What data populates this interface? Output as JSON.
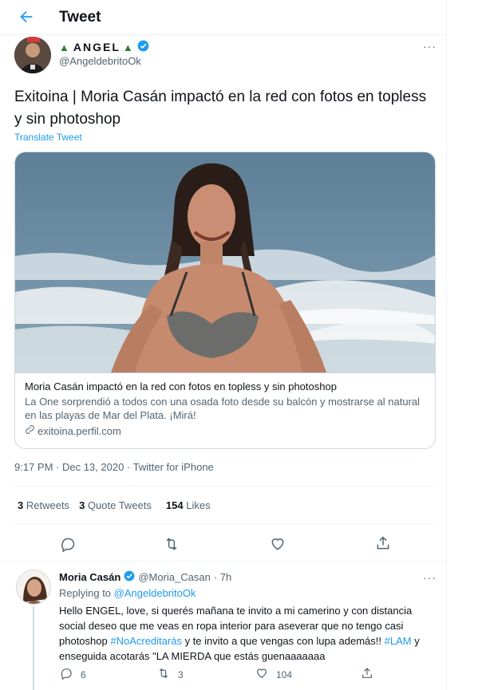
{
  "header": {
    "title": "Tweet"
  },
  "tweet": {
    "author_name": "ANGEL",
    "author_handle": "@AngeldebritoOk",
    "text": "Exitoina | Moria Casán impactó en la red con fotos en topless y sin photoshop",
    "translate_label": "Translate Tweet",
    "card": {
      "title": "Moria Casán impactó en la red con fotos en topless y sin photoshop",
      "description": "La One sorprendió a todos con una osada foto desde su balcón y mostrarse al natural en las playas de Mar del Plata. ¡Mirá!",
      "domain": "exitoina.perfil.com"
    },
    "timestamp": "9:17 PM · Dec 13, 2020 · Twitter for iPhone",
    "stats": {
      "retweets_count": "3",
      "retweets_label": "Retweets",
      "quotes_count": "3",
      "quotes_label": "Quote Tweets",
      "likes_count": "154",
      "likes_label": "Likes"
    }
  },
  "reply": {
    "author_name": "Moria Casán",
    "author_handle": "@Moria_Casan",
    "time": "· 7h",
    "replying_prefix": "Replying to",
    "replying_to": "@AngeldebritoOk",
    "text_part1": "Hello ENGEL, love, si querés mañana te invito a mi camerino y con distancia social deseo que me veas en ropa interior para aseverar que no tengo casi photoshop ",
    "hashtag1": "#NoAcreditarás",
    "text_part2": " y te invito a que vengas con lupa además!! ",
    "hashtag2": "#LAM",
    "text_part3": " y enseguida acotarás \"LA MIERDA que estás guenaaaaaaa",
    "reply_count": "6",
    "retweet_count": "3",
    "like_count": "104"
  },
  "colors": {
    "accent": "#1d9bf0",
    "text": "#0f1419",
    "muted": "#536471",
    "border": "#cfd9de"
  },
  "icons": [
    "back-arrow-icon",
    "verified-badge-icon",
    "tree-icon",
    "more-icon",
    "link-icon",
    "reply-icon",
    "retweet-icon",
    "like-icon",
    "share-icon"
  ]
}
